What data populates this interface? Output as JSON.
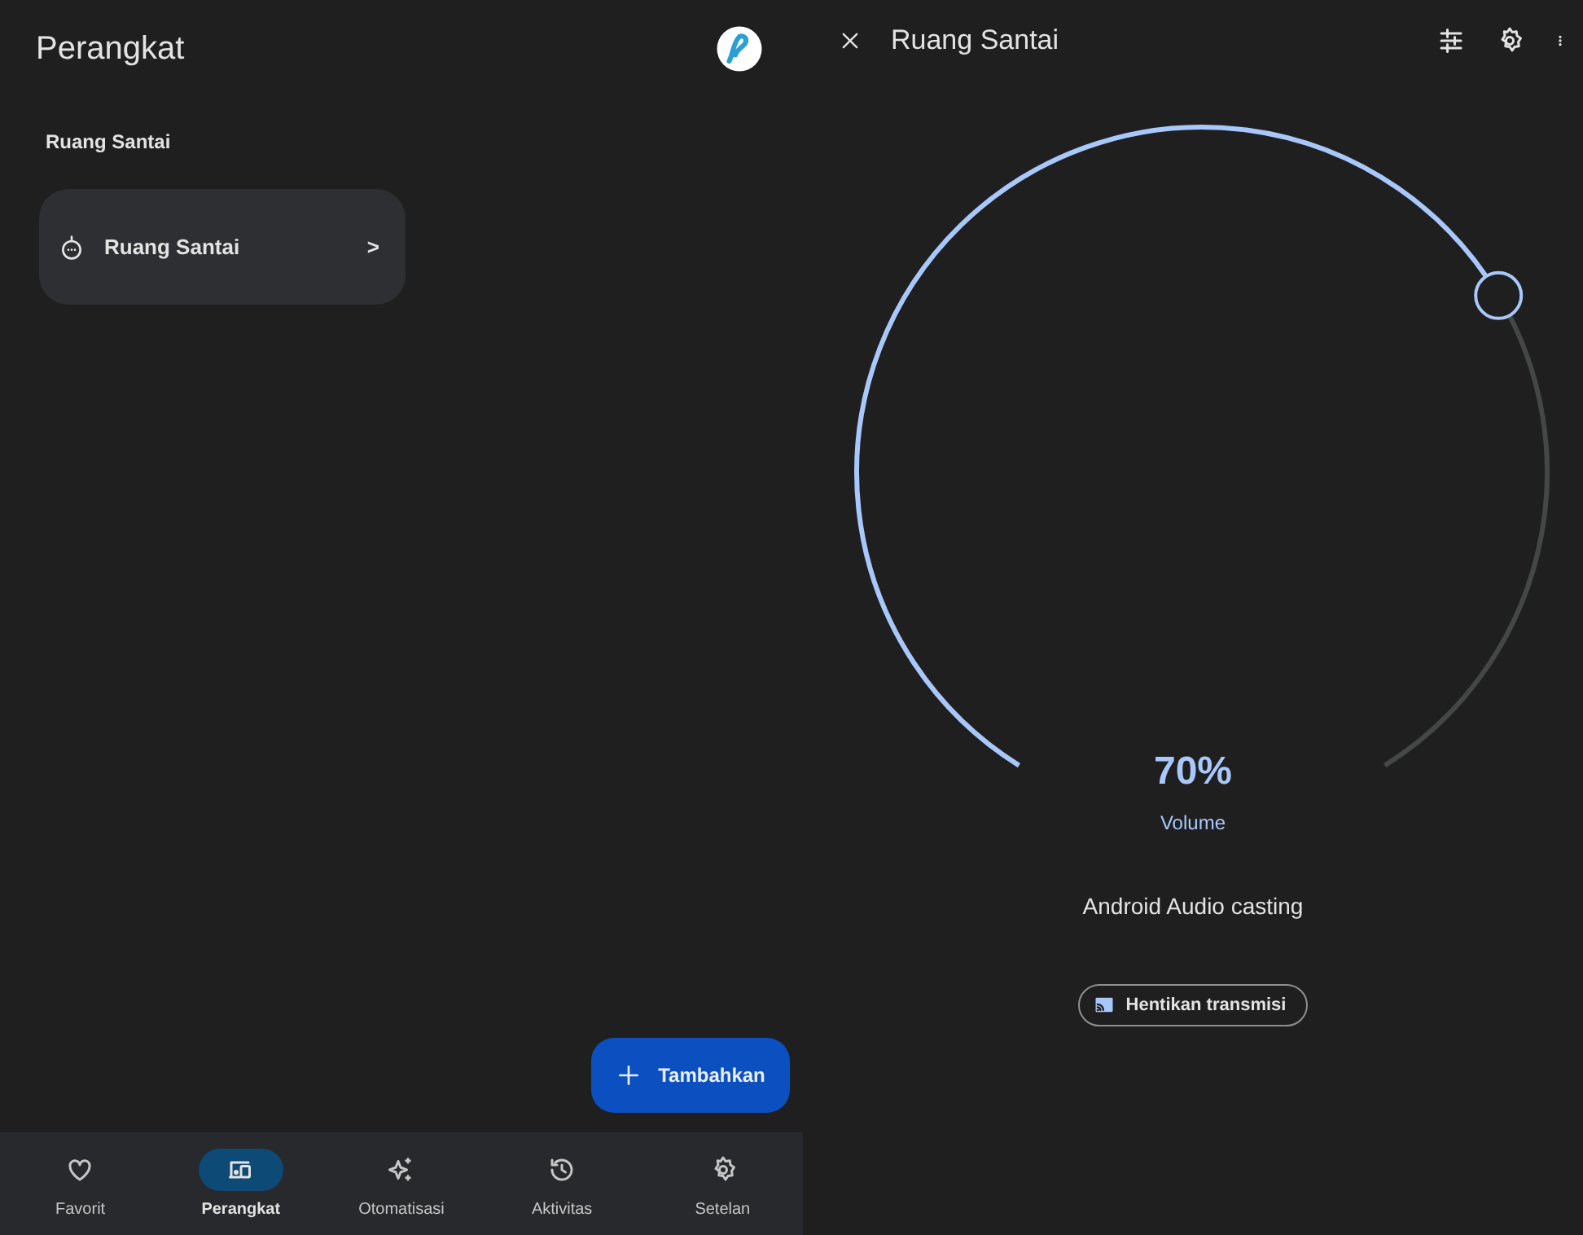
{
  "devices_panel": {
    "title": "Perangkat",
    "section": "Ruang Santai",
    "items": [
      {
        "label": "Ruang Santai",
        "chevron": ">"
      }
    ],
    "add_button": "Tambahkan"
  },
  "bottom_nav": [
    {
      "label": "Favorit",
      "selected": false
    },
    {
      "label": "Perangkat",
      "selected": true
    },
    {
      "label": "Otomatisasi",
      "selected": false
    },
    {
      "label": "Aktivitas",
      "selected": false
    },
    {
      "label": "Setelan",
      "selected": false
    }
  ],
  "detail_panel": {
    "title": "Ruang Santai",
    "volume": {
      "reading": "70%",
      "label": "Volume"
    },
    "status": "Android Audio casting",
    "stop_button": "Hentikan transmisi"
  }
}
